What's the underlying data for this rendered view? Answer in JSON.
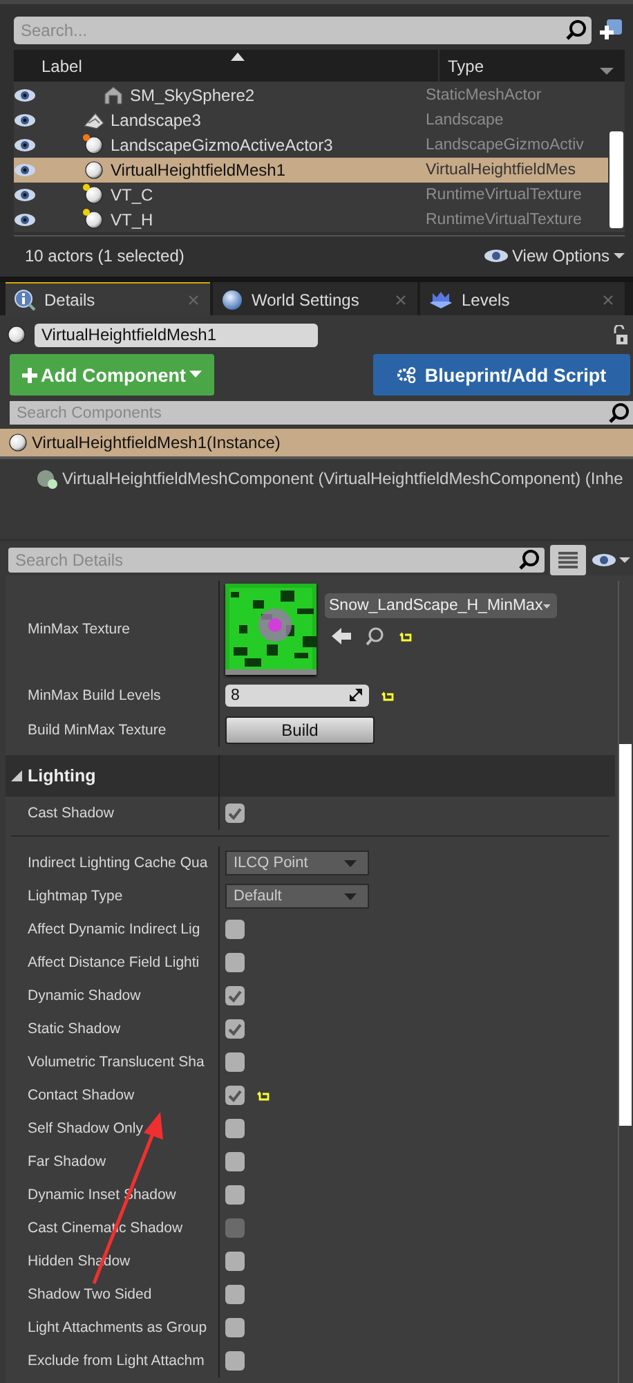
{
  "outliner": {
    "search": {
      "placeholder": "Search..."
    },
    "columns": [
      {
        "label": "Label",
        "sorted": true
      },
      {
        "label": "Type"
      }
    ],
    "rows": [
      {
        "label": "SM_SkySphere2",
        "type": "StaticMeshActor",
        "kind": "mesh",
        "selected": false
      },
      {
        "label": "Landscape3",
        "type": "Landscape",
        "kind": "landscape",
        "selected": false
      },
      {
        "label": "LandscapeGizmoActiveActor3",
        "type": "LandscapeGizmoActiv",
        "kind": "actor",
        "color": "#f07818",
        "selected": false
      },
      {
        "label": "VirtualHeightfieldMesh1",
        "type": "VirtualHeightfieldMes",
        "kind": "actor",
        "selected": true
      },
      {
        "label": "VT_C",
        "type": "RuntimeVirtualTexture",
        "kind": "actor",
        "color": "#f0d000",
        "selected": false
      },
      {
        "label": "VT_H",
        "type": "RuntimeVirtualTexture",
        "kind": "actor",
        "color": "#f0d000",
        "selected": false
      }
    ],
    "status": "10 actors (1 selected)",
    "view_options": "View Options"
  },
  "details": {
    "tabs": [
      {
        "label": "Details",
        "kind": "info",
        "selected": true
      },
      {
        "label": "World Settings",
        "kind": "world",
        "selected": false
      },
      {
        "label": "Levels",
        "kind": "levels",
        "selected": false
      }
    ],
    "actor_name": "VirtualHeightfieldMesh1",
    "add_component": "Add Component",
    "blueprint": "Blueprint/Add Script",
    "component_search": {
      "placeholder": "Search Components"
    },
    "components": [
      {
        "label": "VirtualHeightfieldMesh1(Instance)",
        "selected": true,
        "children": [
          {
            "label": "VirtualHeightfieldMeshComponent (VirtualHeightfieldMeshComponent) (Inhe",
            "selected": false
          }
        ]
      }
    ],
    "search": {
      "placeholder": "Search Details"
    },
    "properties": [
      {
        "kind": "asset",
        "label": "MinMax Texture",
        "value": "Snow_LandScape_H_MinMax",
        "modified": true
      },
      {
        "kind": "number",
        "label": "MinMax Build Levels",
        "value": "8",
        "modified": true
      },
      {
        "kind": "button",
        "label": "Build MinMax Texture",
        "value": "Build"
      },
      {
        "kind": "category",
        "label": "Lighting",
        "expanded": true
      },
      {
        "kind": "checkbox",
        "label": "Cast Shadow",
        "checked": true,
        "disabled": false
      },
      {
        "kind": "separator"
      },
      {
        "kind": "dropdown",
        "label": "Indirect Lighting Cache Qua",
        "value": "ILCQ Point"
      },
      {
        "kind": "dropdown",
        "label": "Lightmap Type",
        "value": "Default"
      },
      {
        "kind": "checkbox",
        "label": "Affect Dynamic Indirect Lig",
        "checked": false,
        "disabled": false
      },
      {
        "kind": "checkbox",
        "label": "Affect Distance Field Lighti",
        "checked": false,
        "disabled": false
      },
      {
        "kind": "checkbox",
        "label": "Dynamic Shadow",
        "checked": true,
        "disabled": false
      },
      {
        "kind": "checkbox",
        "label": "Static Shadow",
        "checked": true,
        "disabled": false
      },
      {
        "kind": "checkbox",
        "label": "Volumetric Translucent Sha",
        "checked": false,
        "disabled": false
      },
      {
        "kind": "checkbox",
        "label": "Contact Shadow",
        "checked": true,
        "disabled": false,
        "modified": true
      },
      {
        "kind": "checkbox",
        "label": "Self Shadow Only",
        "checked": false,
        "disabled": false
      },
      {
        "kind": "checkbox",
        "label": "Far Shadow",
        "checked": false,
        "disabled": false
      },
      {
        "kind": "checkbox",
        "label": "Dynamic Inset Shadow",
        "checked": false,
        "disabled": false
      },
      {
        "kind": "checkbox",
        "label": "Cast Cinematic Shadow",
        "checked": false,
        "disabled": true
      },
      {
        "kind": "checkbox",
        "label": "Hidden Shadow",
        "checked": false,
        "disabled": false
      },
      {
        "kind": "checkbox",
        "label": "Shadow Two Sided",
        "checked": false,
        "disabled": false
      },
      {
        "kind": "checkbox",
        "label": "Light Attachments as Group",
        "checked": false,
        "disabled": false
      },
      {
        "kind": "checkbox",
        "label": "Exclude from Light Attachm",
        "checked": false,
        "disabled": false
      }
    ],
    "annotations": [
      {
        "kind": "arrow"
      }
    ]
  }
}
